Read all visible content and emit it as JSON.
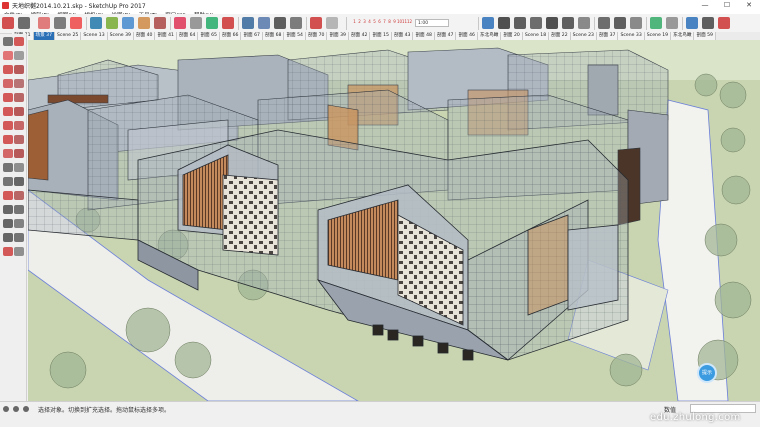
{
  "window": {
    "title": "天地织樾2014.10.21.skp - SketchUp Pro 2017",
    "minimize_glyph": "—",
    "maximize_glyph": "☐",
    "close_glyph": "✕"
  },
  "menu": [
    "文件(F)",
    "编辑(E)",
    "视图(V)",
    "相机(C)",
    "绘图(R)",
    "工具(T)",
    "窗口(W)",
    "帮助(H)"
  ],
  "toolbar": {
    "layer_numbers": [
      "1",
      "2",
      "3",
      "4",
      "5",
      "6",
      "7",
      "8",
      "9",
      "10",
      "11",
      "12"
    ],
    "zoom_value": "1:00",
    "icons": [
      "select-icon",
      "eraser-icon",
      "line-icon",
      "arc-icon",
      "shape-icon",
      "push-pull-icon",
      "move-icon",
      "rotate-icon",
      "scale-icon",
      "offset-icon",
      "paint-icon",
      "tape-icon",
      "text-icon",
      "axes-icon",
      "orbit-icon",
      "pan-icon",
      "zoom-icon",
      "zoom-extents-icon",
      "section-icon",
      "styles-icon",
      "iso-view-icon",
      "top-view-icon",
      "front-view-icon",
      "right-view-icon",
      "back-view-icon",
      "left-view-icon",
      "xray-icon",
      "wireframe-icon",
      "hidden-line-icon",
      "shaded-icon",
      "textured-icon",
      "monochrome-icon",
      "home-icon",
      "warehouse-icon",
      "extension-icon"
    ]
  },
  "scenes": {
    "active_index": 1,
    "tabs": [
      "剖面 71",
      "场景 37",
      "Scene 25",
      "Scene 13",
      "Scene 39",
      "剖面 40",
      "剖面 41",
      "剖面 64",
      "剖面 65",
      "剖面 66",
      "剖面 67",
      "剖面 68",
      "剖面 54",
      "剖面 70",
      "剖面 39",
      "剖面 42",
      "剖面 15",
      "剖面 43",
      "剖面 48",
      "剖面 47",
      "剖面 46",
      "东北鸟瞰",
      "剖面 20",
      "Scene 18",
      "剖面 22",
      "Scene 23",
      "剖面 37",
      "Scene 33",
      "Scene 19",
      "东北鸟瞰",
      "剖面 59"
    ]
  },
  "status": {
    "message": "选择对象。切换到扩充选择。拖动鼠标选择多项。",
    "measurements_label": "数值",
    "measurements_value": ""
  },
  "watermark": "edu.zhulong.com",
  "badge": "提示",
  "colors": {
    "glass": "#9aa6b4",
    "wood": "#b06a3c",
    "grass": "#c9d9ab",
    "road": "#f4f4f2",
    "tree": "#8fa57e",
    "active_tab": "#2b6fb7"
  }
}
